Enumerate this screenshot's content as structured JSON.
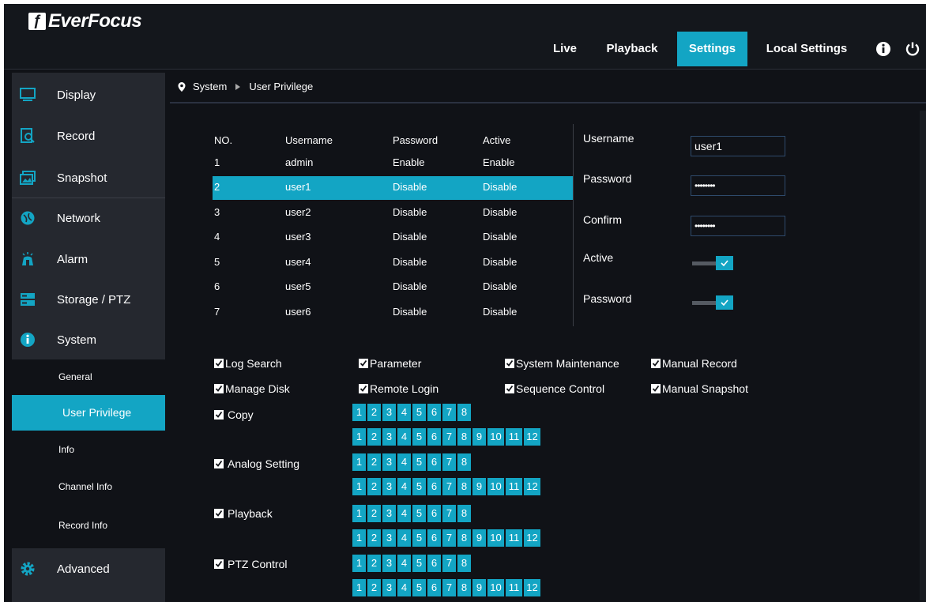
{
  "brand": "EverFocus",
  "nav": {
    "live": "Live",
    "playback": "Playback",
    "settings": "Settings",
    "local_settings": "Local Settings"
  },
  "sidebar": {
    "items": [
      {
        "label": "Display",
        "icon": "monitor-icon"
      },
      {
        "label": "Record",
        "icon": "record-icon"
      },
      {
        "label": "Snapshot",
        "icon": "snapshot-icon"
      },
      {
        "label": "Network",
        "icon": "network-icon"
      },
      {
        "label": "Alarm",
        "icon": "alarm-icon"
      },
      {
        "label": "Storage / PTZ",
        "icon": "storage-icon"
      },
      {
        "label": "System",
        "icon": "info-icon"
      }
    ],
    "sub_items": [
      "General",
      "User Privilege",
      "Info",
      "Channel Info",
      "Record Info"
    ],
    "advanced": "Advanced"
  },
  "breadcrumb": {
    "root": "System",
    "current": "User Privilege"
  },
  "table": {
    "headers": [
      "NO.",
      "Username",
      "Password",
      "Active"
    ],
    "rows": [
      [
        "1",
        "admin",
        "Enable",
        "Enable"
      ],
      [
        "2",
        "user1",
        "Disable",
        "Disable"
      ],
      [
        "3",
        "user2",
        "Disable",
        "Disable"
      ],
      [
        "4",
        "user3",
        "Disable",
        "Disable"
      ],
      [
        "5",
        "user4",
        "Disable",
        "Disable"
      ],
      [
        "6",
        "user5",
        "Disable",
        "Disable"
      ],
      [
        "7",
        "user6",
        "Disable",
        "Disable"
      ]
    ],
    "selected_index": 1
  },
  "form": {
    "username_label": "Username",
    "username_value": "user1",
    "password_label": "Password",
    "password_value": "••••••••",
    "confirm_label": "Confirm",
    "confirm_value": "••••••••",
    "active_label": "Active",
    "password_toggle_label": "Password"
  },
  "permissions": {
    "log_search": "Log Search",
    "parameter": "Parameter",
    "system_maintenance": "System Maintenance",
    "manual_record": "Manual Record",
    "manage_disk": "Manage Disk",
    "remote_login": "Remote Login",
    "sequence_control": "Sequence Control",
    "manual_snapshot": "Manual Snapshot",
    "copy": "Copy",
    "analog_setting": "Analog Setting",
    "playback": "Playback",
    "ptz_control": "PTZ Control"
  },
  "channels_short": [
    "1",
    "2",
    "3",
    "4",
    "5",
    "6",
    "7",
    "8"
  ],
  "channels_long": [
    "1",
    "2",
    "3",
    "4",
    "5",
    "6",
    "7",
    "8",
    "9",
    "10",
    "11",
    "12"
  ],
  "colors": {
    "accent": "#13a5c4",
    "background": "#101217",
    "sidebar": "#25282f"
  }
}
